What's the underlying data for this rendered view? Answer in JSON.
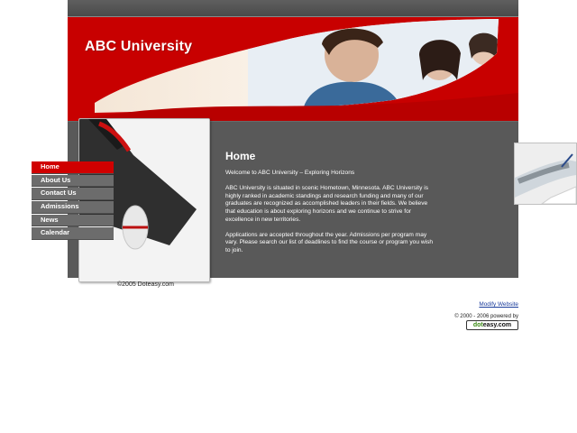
{
  "header": {
    "site_title": "ABC University"
  },
  "navigation": {
    "items": [
      {
        "label": "Home",
        "active": true
      },
      {
        "label": "About Us",
        "active": false
      },
      {
        "label": "Contact Us",
        "active": false
      },
      {
        "label": "Admissions",
        "active": false
      },
      {
        "label": "News",
        "active": false
      },
      {
        "label": "Calendar",
        "active": false
      }
    ]
  },
  "content": {
    "heading": "Home",
    "welcome": "Welcome to ABC University – Exploring Horizons",
    "paragraph_1": "ABC University is situated in scenic Hometown, Minnesota. ABC University is highly ranked in academic standings and research funding and many of our graduates are recognized as accomplished leaders in their fields.  We believe that education is about exploring horizons and we continue to strive for excellence in new territories.",
    "paragraph_2": "Applications are accepted throughout the year.  Admissions per program may vary.  Please search our list of deadlines to find the course or program you wish to join."
  },
  "footer": {
    "copyright": "©2005 Doteasy.com",
    "modify_link": "Modify Website",
    "powered_by": "© 2000 - 2006 powered by",
    "powered_logo_prefix": "dot",
    "powered_logo_suffix": "easy.com"
  },
  "colors": {
    "brand_red": "#c80000",
    "panel_gray": "#595959",
    "nav_gray": "#6c6c6c",
    "nav_active": "#d00000",
    "link_blue": "#1a3c9c"
  },
  "icons": {
    "graduation_cap": "graduation-cap-icon",
    "students_photo": "students-photo",
    "writing_hand": "writing-hand-photo"
  }
}
